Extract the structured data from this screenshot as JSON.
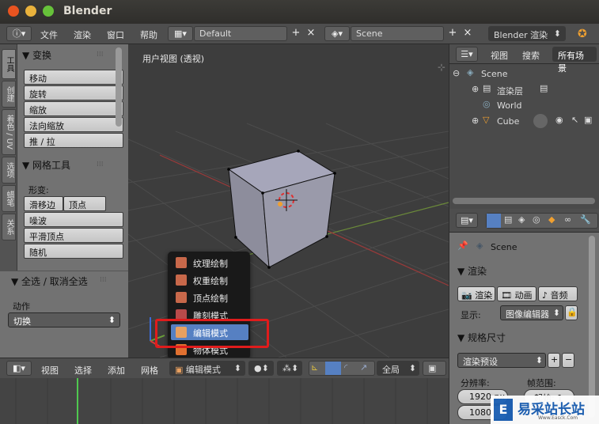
{
  "window": {
    "title": "Blender"
  },
  "info_header": {
    "menus": [
      "文件",
      "渲染",
      "窗口",
      "帮助"
    ],
    "screen_layout": "Default",
    "scene": "Scene",
    "render_engine": "Blender 渲染"
  },
  "tool_tabs": [
    "工具",
    "创建",
    "着色 / UV",
    "选项",
    "蜡笔",
    "关系"
  ],
  "tool_shelf": {
    "transform_header": "▼ 变换",
    "transform_buttons": [
      "移动",
      "旋转",
      "缩放",
      "法向缩放",
      "推 / 拉"
    ],
    "mesh_tools_header": "▼ 网格工具",
    "deform_label": "形变:",
    "slide_edge": "滑移边",
    "vertex": "顶点",
    "mesh_buttons": [
      "噪波",
      "平滑顶点",
      "随机"
    ]
  },
  "operator_panel": {
    "header": "▼ 全选 / 取消全选",
    "action_label": "动作",
    "action_value": "切换"
  },
  "viewport": {
    "title": "用户视图 (透视)"
  },
  "mode_popup": {
    "items": [
      {
        "label": "纹理绘制",
        "icon": "texture-paint-icon",
        "color": "#c8684a"
      },
      {
        "label": "权重绘制",
        "icon": "weight-paint-icon",
        "color": "#c8684a"
      },
      {
        "label": "顶点绘制",
        "icon": "vertex-paint-icon",
        "color": "#c8684a"
      },
      {
        "label": "雕刻模式",
        "icon": "sculpt-icon",
        "color": "#b84a4a"
      },
      {
        "label": "编辑模式",
        "icon": "edit-mode-icon",
        "color": "#e8a060",
        "selected": true
      },
      {
        "label": "物体模式",
        "icon": "object-mode-icon",
        "color": "#e07030"
      }
    ]
  },
  "viewport_header": {
    "menus": [
      "视图",
      "选择",
      "添加",
      "网格"
    ],
    "mode": "编辑模式",
    "pivot": "全局"
  },
  "outliner": {
    "view": "视图",
    "search": "搜索",
    "filter": "所有场景",
    "rows": [
      {
        "label": "Scene",
        "icon": "scene-icon"
      },
      {
        "label": "渲染层",
        "icon": "render-layer-icon"
      },
      {
        "label": "World",
        "icon": "world-icon"
      },
      {
        "label": "Cube",
        "icon": "cube-object-icon"
      }
    ]
  },
  "properties": {
    "scene_name": "Scene",
    "render_header": "▼ 渲染",
    "render_buttons": [
      "渲染",
      "动画",
      "音频"
    ],
    "display_label": "显示:",
    "display_value": "图像编辑器",
    "dimensions_header": "▼ 规格尺寸",
    "preset_value": "渲染预设",
    "resolution_label": "分辨率:",
    "frame_range_label": "帧范围:",
    "res_x": "1920 px",
    "res_y": "1080",
    "start_frame": "起始: 1"
  },
  "watermark": {
    "text": "易采站长站",
    "subtext": "Www.Easck.Com"
  },
  "colors": {
    "accent": "#5680c2",
    "highlight_box": "#e01c1c",
    "header_bg": "#4e4e4e",
    "panel_bg": "#727272",
    "viewport_bg": "#3d3d3d"
  }
}
